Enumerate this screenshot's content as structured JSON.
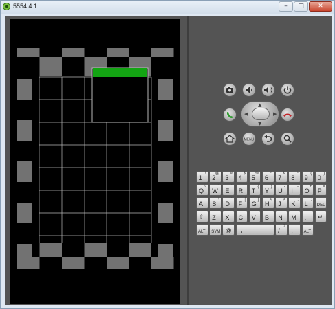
{
  "window": {
    "title": "5554:4.1",
    "minimize_glyph": "–",
    "maximize_glyph": "□",
    "close_glyph": "✕"
  },
  "controls": {
    "buttons": [
      {
        "name": "camera-button",
        "icon": "camera-icon"
      },
      {
        "name": "volume-down-button",
        "icon": "volume-down-icon"
      },
      {
        "name": "volume-up-button",
        "icon": "volume-up-icon"
      },
      {
        "name": "power-button",
        "icon": "power-icon"
      },
      {
        "name": "call-button",
        "icon": "phone-call-icon",
        "color": "#2b9a2b"
      },
      {
        "name": "end-call-button",
        "icon": "phone-end-icon",
        "color": "#c0262b"
      },
      {
        "name": "home-button",
        "icon": "home-icon"
      },
      {
        "name": "menu-button",
        "icon": "menu-icon",
        "label": "MENU"
      },
      {
        "name": "back-button",
        "icon": "back-icon"
      },
      {
        "name": "search-button",
        "icon": "search-icon"
      }
    ]
  },
  "keyboard": {
    "rows": [
      [
        {
          "k": "1",
          "s": "!"
        },
        {
          "k": "2",
          "s": "@"
        },
        {
          "k": "3",
          "s": "#"
        },
        {
          "k": "4",
          "s": "$"
        },
        {
          "k": "5",
          "s": "%"
        },
        {
          "k": "6",
          "s": "^"
        },
        {
          "k": "7",
          "s": "&"
        },
        {
          "k": "8",
          "s": "*"
        },
        {
          "k": "9",
          "s": "("
        },
        {
          "k": "0",
          "s": ")"
        }
      ],
      [
        {
          "k": "Q",
          "s": "~"
        },
        {
          "k": "W",
          "s": "\""
        },
        {
          "k": "E",
          "s": "´"
        },
        {
          "k": "R",
          "s": ""
        },
        {
          "k": "T",
          "s": "{"
        },
        {
          "k": "Y",
          "s": "}"
        },
        {
          "k": "U",
          "s": "-"
        },
        {
          "k": "I",
          "s": "-"
        },
        {
          "k": "O",
          "s": "+"
        },
        {
          "k": "P",
          "s": "="
        }
      ],
      [
        {
          "k": "A",
          "s": ""
        },
        {
          "k": "S",
          "s": "\\"
        },
        {
          "k": "D",
          "s": "´"
        },
        {
          "k": "F",
          "s": "["
        },
        {
          "k": "G",
          "s": "]"
        },
        {
          "k": "H",
          "s": "<"
        },
        {
          "k": "J",
          "s": ">"
        },
        {
          "k": "K",
          "s": ";"
        },
        {
          "k": "L",
          "s": ":"
        },
        {
          "k": "DEL",
          "s": ""
        }
      ],
      [
        {
          "k": "⇧",
          "s": ""
        },
        {
          "k": "Z",
          "s": ""
        },
        {
          "k": "X",
          "s": ""
        },
        {
          "k": "C",
          "s": ""
        },
        {
          "k": "V",
          "s": ""
        },
        {
          "k": "B",
          "s": ""
        },
        {
          "k": "N",
          "s": ""
        },
        {
          "k": "M",
          "s": ""
        },
        {
          "k": ".",
          "s": ""
        },
        {
          "k": "↵",
          "s": ""
        }
      ],
      [
        {
          "k": "ALT",
          "s": ""
        },
        {
          "k": "SYM",
          "s": ""
        },
        {
          "k": "@",
          "s": ""
        },
        {
          "k": "␣",
          "s": ""
        },
        {
          "k": "/",
          "s": "?"
        },
        {
          "k": ",",
          "s": ""
        },
        {
          "k": "ALT",
          "s": ""
        }
      ]
    ]
  },
  "colors": {
    "client_bg": "#545454",
    "screen_bg": "#000000",
    "accent_green": "#13a413",
    "grid_line": "#b9b9b9",
    "checker_gray": "#727272"
  }
}
